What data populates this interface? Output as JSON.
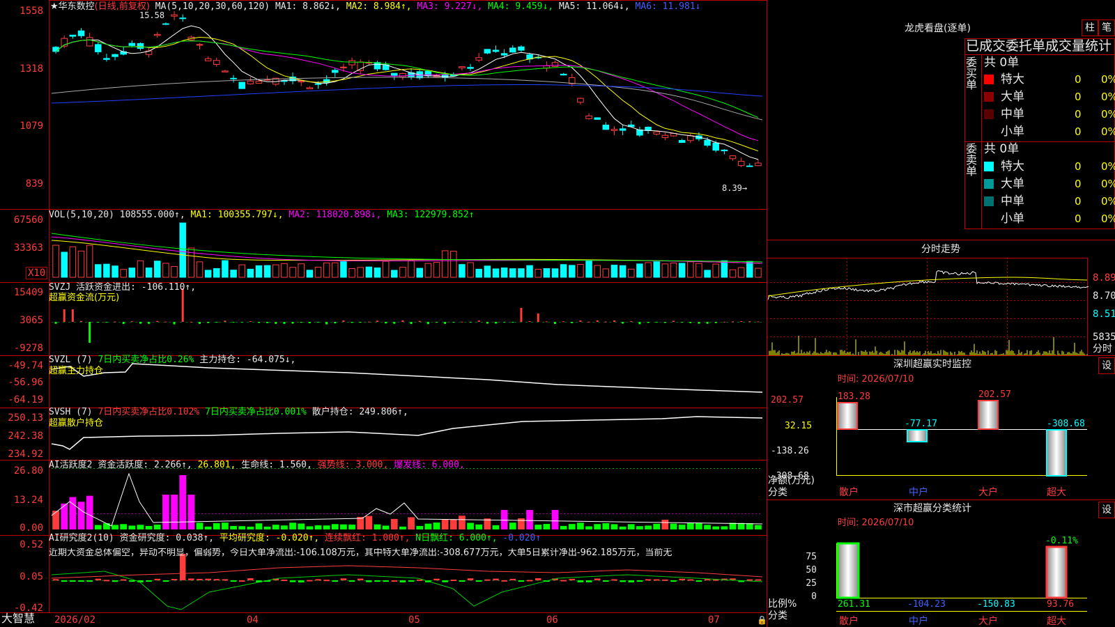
{
  "app_name": "大智慧",
  "kline": {
    "header_title": "★华东数控",
    "header_period": "(日线,前复权)",
    "header_ma_def": "MA(5,10,20,30,60,120)",
    "ma1": "MA1: 8.862↓,",
    "ma2": "MA2: 8.984↑,",
    "ma3": "MA3: 9.227↓,",
    "ma4": "MA4: 9.459↓,",
    "ma5": "MA5: 11.064↓,",
    "ma6": "MA6: 11.981↓",
    "ylabels": [
      "1558",
      "1318",
      "1079",
      "839"
    ],
    "high_marker": "15.58",
    "low_marker": "8.39→"
  },
  "volume": {
    "title": "VOL(5,10,20)",
    "value": "108555.000↑,",
    "ma1": "MA1: 100355.797↓,",
    "ma2": "MA2: 118020.898↓,",
    "ma3": "MA3: 122979.852↑",
    "ylabels": [
      "67560",
      "33363"
    ],
    "unit_badge": "X10"
  },
  "svzj": {
    "title": "SVZJ  活跃资金进出: -106.110↑,",
    "subtitle": "超赢资金流(万元)",
    "ylabels": [
      "15409",
      "3065",
      "-9278"
    ]
  },
  "svzl": {
    "title": "SVZL (7)",
    "part2": "7日内买卖净占比0.26%",
    "part3": "主力持仓: -64.075↓,",
    "subtitle": "超赢主力持仓",
    "ylabels": [
      "-49.74",
      "-56.96",
      "-64.19"
    ]
  },
  "svsh": {
    "title": "SVSH (7)",
    "part2": "7日内买卖净占比0.102%",
    "part3": "7日内买卖净占比0.001%",
    "part4": "散户持仓: 249.806↑,",
    "subtitle": "超赢散户持仓",
    "ylabels": [
      "250.13",
      "242.38",
      "234.92"
    ]
  },
  "ai_active": {
    "title": "AI活跃度2",
    "p1": "资金活跃度: 2.266↑,",
    "p2": "26.801,",
    "p3": "生命线: 1.560,",
    "p4": "强势线: 3.000,",
    "p5": "爆发线: 6.000,",
    "ylabels": [
      "26.80",
      "13.24",
      "0.00"
    ]
  },
  "ai_research": {
    "title": "AI研究度2(10)",
    "p1": "资金研究度: 0.038↑,",
    "p2": "平均研究度: -0.020↑,",
    "p3": "连续飘红: 1.000↑,",
    "p4": "N日飘红: 6.000↑,",
    "p5": "-0.020↑",
    "comment": "近期大资金总体偏空，异动不明显，偏弱势，今日大单净流出:-106.108万元，其中特大单净流出:-308.677万元，大单5日累计净出-962.185万元，当前无",
    "ylabels": [
      "0.52",
      "0.05",
      "-0.42"
    ]
  },
  "xaxis": {
    "labels": [
      "2026/02",
      "04",
      "05",
      "06",
      "07"
    ]
  },
  "right": {
    "dragon_title": "龙虎看盘(逐单)",
    "btn_zhu": "柱",
    "btn_bi": "笔",
    "stats_header": "已成交委托单成交量统计",
    "buy_label": "委买单",
    "sell_label": "委卖单",
    "buy_total": "共 0单",
    "sell_total": "共 0单",
    "buy_rows": [
      {
        "label": "特大",
        "count": "0",
        "pct": "0%"
      },
      {
        "label": "大单",
        "count": "0",
        "pct": "0%"
      },
      {
        "label": "中单",
        "count": "0",
        "pct": "0%"
      },
      {
        "label": "小单",
        "count": "0",
        "pct": "0%"
      }
    ],
    "sell_rows": [
      {
        "label": "特大",
        "count": "0",
        "pct": "0%"
      },
      {
        "label": "大单",
        "count": "0",
        "pct": "0%"
      },
      {
        "label": "中单",
        "count": "0",
        "pct": "0%"
      },
      {
        "label": "小单",
        "count": "0",
        "pct": "0%"
      }
    ],
    "intraday_title": "分时走势",
    "intraday_ylabels": [
      "8.89",
      "8.70",
      "8.51"
    ],
    "intraday_vol_label": "5835",
    "intraday_vol_unit": "分时",
    "monitor_title": "深圳超赢实时监控",
    "monitor_btn": "设",
    "monitor_date": "时间: 2026/07/10",
    "monitor_ylabels": [
      "202.57",
      "32.15",
      "-138.26",
      "-308.68"
    ],
    "monitor_bar_values": [
      "183.28",
      "-77.17",
      "202.57",
      "-308.68"
    ],
    "monitor_axis_label": "净额(万元)",
    "monitor_cat_label": "分类",
    "categories": [
      "散户",
      "中户",
      "大户",
      "超大"
    ],
    "stats_title": "深市超赢分类统计",
    "stats_btn": "设",
    "stats_date": "时间: 2026/07/10",
    "stats_ylabels": [
      "75",
      "50",
      "25",
      "0"
    ],
    "stats_top_label": "-0.11%",
    "stats_axis_label": "比例%",
    "stats_bottom_values": [
      "261.31",
      "-104.23",
      "-150.83",
      "93.76"
    ],
    "stats_cat_label": "分类"
  },
  "colors": {
    "up": "#ff3c3c",
    "down": "#00ffff",
    "frame": "#c00000",
    "green": "#00ff00",
    "magenta": "#ff00ff",
    "yellow": "#ffff00"
  }
}
